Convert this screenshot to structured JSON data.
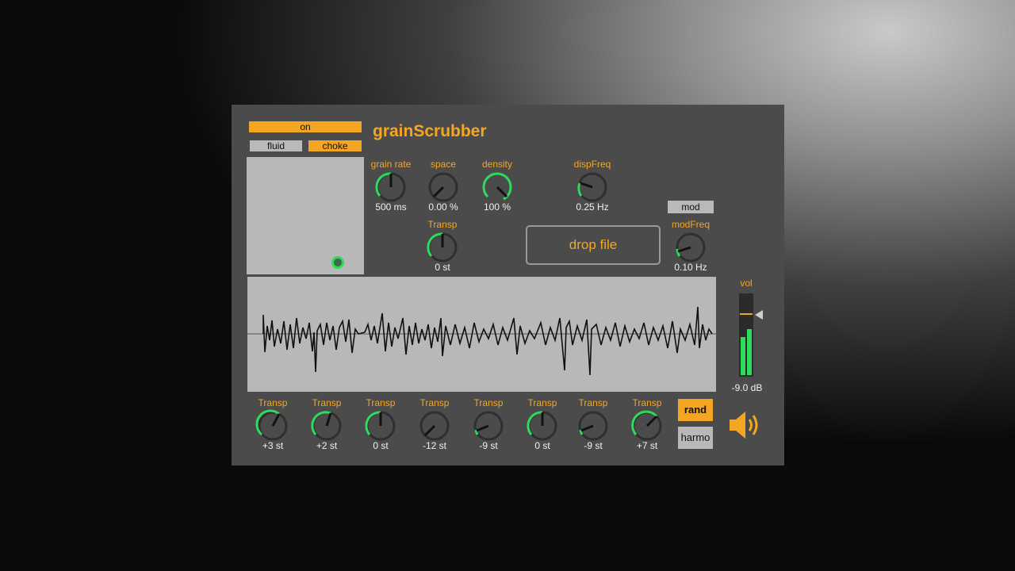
{
  "app": {
    "title": "grainScrubber"
  },
  "toggles": {
    "on": "on",
    "fluid": "fluid",
    "choke": "choke",
    "mod": "mod"
  },
  "knobs": {
    "grain_rate": {
      "label": "grain rate",
      "value": "500 ms"
    },
    "space": {
      "label": "space",
      "value": "0.00 %"
    },
    "density": {
      "label": "density",
      "value": "100 %"
    },
    "dispfreq": {
      "label": "dispFreq",
      "value": "0.25 Hz"
    },
    "transp": {
      "label": "Transp",
      "value": "0 st"
    },
    "modfreq": {
      "label": "modFreq",
      "value": "0.10 Hz"
    }
  },
  "drop_file": "drop file",
  "volume": {
    "label": "vol",
    "value": "-9.0 dB"
  },
  "bottom_knobs": [
    {
      "label": "Transp",
      "value": "+3 st"
    },
    {
      "label": "Transp",
      "value": "+2 st"
    },
    {
      "label": "Transp",
      "value": "0 st"
    },
    {
      "label": "Transp",
      "value": "-12 st"
    },
    {
      "label": "Transp",
      "value": "-9 st"
    },
    {
      "label": "Transp",
      "value": "0 st"
    },
    {
      "label": "Transp",
      "value": "-9 st"
    },
    {
      "label": "Transp",
      "value": "+7 st"
    }
  ],
  "buttons": {
    "rand": "rand",
    "harmo": "harmo"
  },
  "icons": {
    "speaker": "speaker-icon"
  },
  "colors": {
    "accent": "#f4a623",
    "knob_active": "#2cdc5a",
    "panel": "#4b4b4b"
  }
}
